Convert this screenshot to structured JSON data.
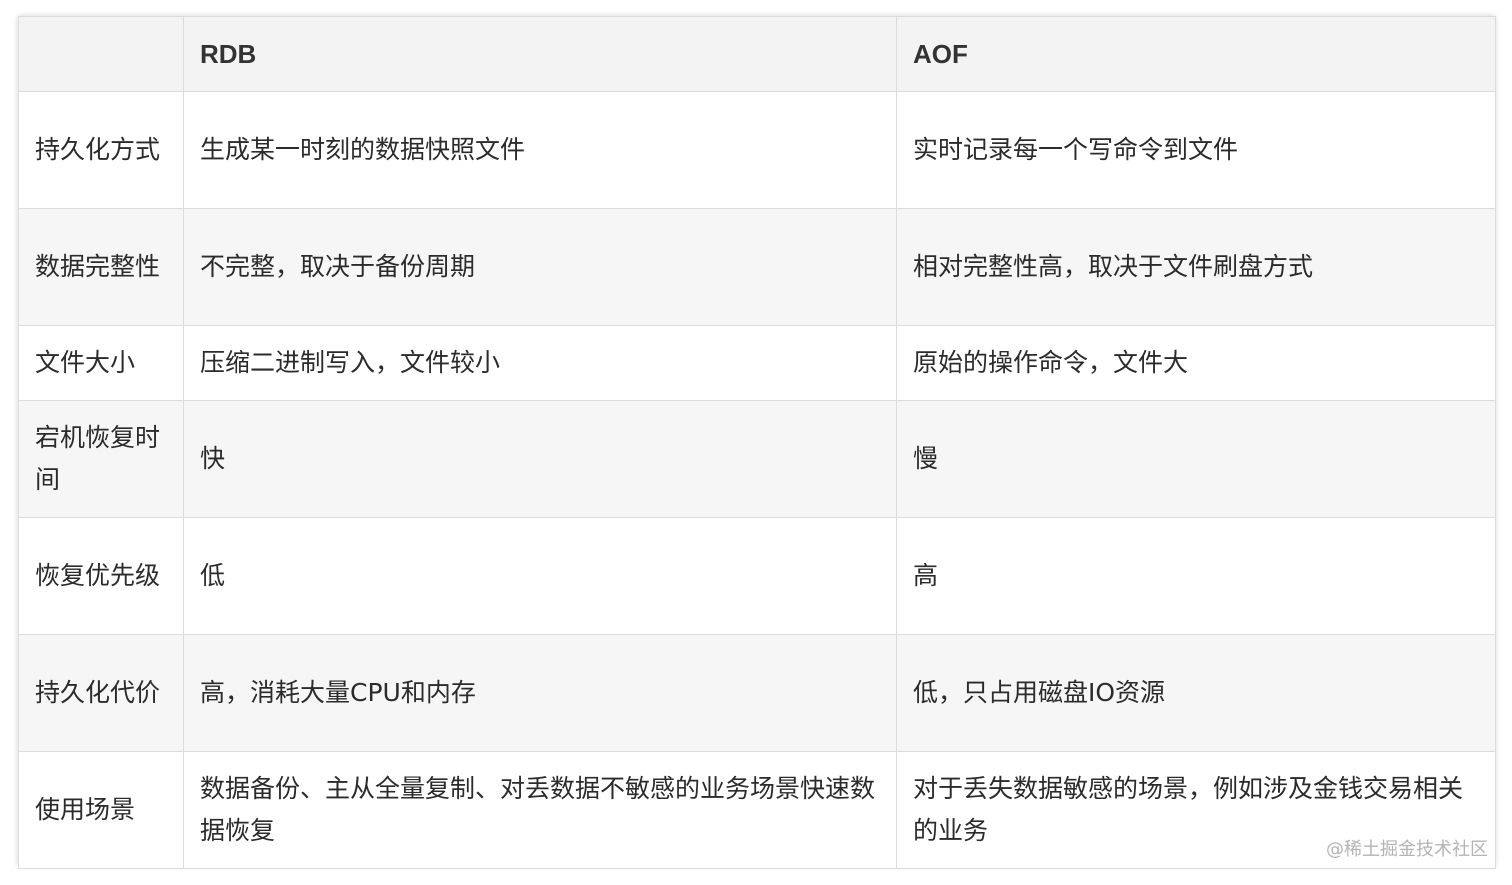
{
  "table": {
    "headers": [
      "",
      "RDB",
      "AOF"
    ],
    "rows": [
      [
        "持久化方式",
        "生成某一时刻的数据快照文件",
        "实时记录每一个写命令到文件"
      ],
      [
        "数据完整性",
        "不完整，取决于备份周期",
        "相对完整性高，取决于文件刷盘方式"
      ],
      [
        "文件大小",
        "压缩二进制写入，文件较小",
        "原始的操作命令，文件大"
      ],
      [
        "宕机恢复时间",
        "快",
        "慢"
      ],
      [
        "恢复优先级",
        "低",
        "高"
      ],
      [
        "持久化代价",
        "高，消耗大量CPU和内存",
        "低，只占用磁盘IO资源"
      ],
      [
        "使用场景",
        "数据备份、主从全量复制、对丢数据不敏感的业务场景快速数据恢复",
        "对于丢失数据敏感的场景，例如涉及金钱交易相关的业务"
      ]
    ]
  },
  "watermark": "@稀土掘金技术社区"
}
